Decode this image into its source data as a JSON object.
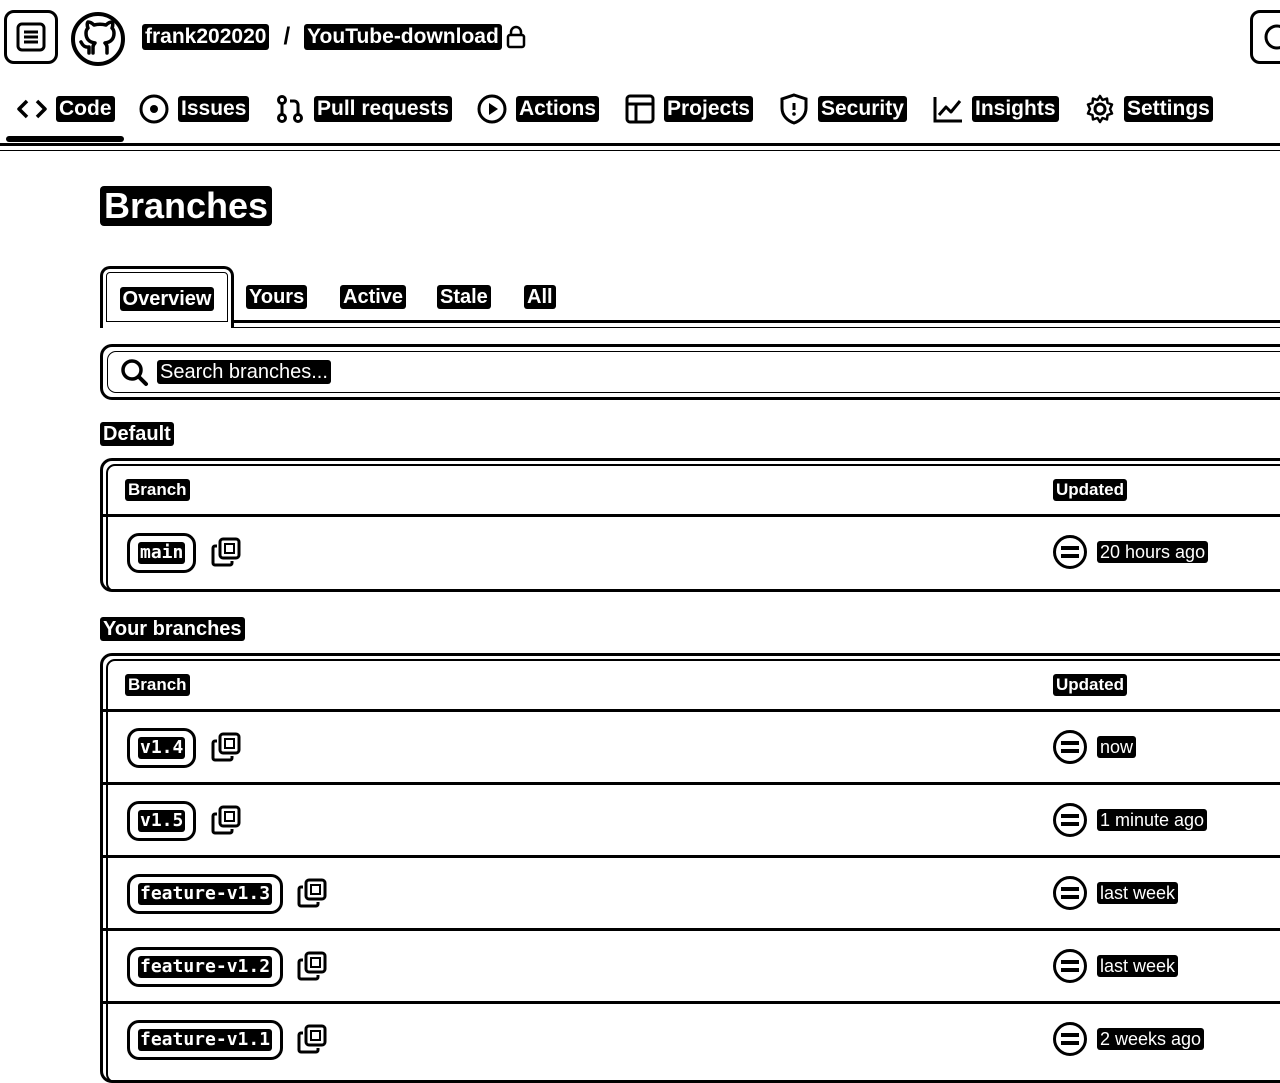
{
  "header": {
    "owner": "frank202020",
    "separator": "/",
    "repo": "YouTube-download"
  },
  "nav": {
    "tabs": [
      {
        "label": "Code",
        "icon": "code-icon"
      },
      {
        "label": "Issues",
        "icon": "issue-opened-icon"
      },
      {
        "label": "Pull requests",
        "icon": "git-pull-request-icon"
      },
      {
        "label": "Actions",
        "icon": "play-icon"
      },
      {
        "label": "Projects",
        "icon": "table-icon"
      },
      {
        "label": "Security",
        "icon": "shield-icon"
      },
      {
        "label": "Insights",
        "icon": "graph-icon"
      },
      {
        "label": "Settings",
        "icon": "gear-icon"
      }
    ],
    "selected": "Code"
  },
  "page": {
    "title": "Branches"
  },
  "branch_tabs": {
    "items": [
      "Overview",
      "Yours",
      "Active",
      "Stale",
      "All"
    ],
    "selected": "Overview"
  },
  "search": {
    "placeholder": "Search branches..."
  },
  "default_section": {
    "label": "Default",
    "col_branch": "Branch",
    "col_updated": "Updated",
    "rows": [
      {
        "branch": "main",
        "updated": "20 hours ago"
      }
    ]
  },
  "your_section": {
    "label": "Your branches",
    "col_branch": "Branch",
    "col_updated": "Updated",
    "rows": [
      {
        "branch": "v1.4",
        "updated": "now"
      },
      {
        "branch": "v1.5",
        "updated": "1 minute ago"
      },
      {
        "branch": "feature-v1.3",
        "updated": "last week"
      },
      {
        "branch": "feature-v1.2",
        "updated": "last week"
      },
      {
        "branch": "feature-v1.1",
        "updated": "2 weeks ago"
      }
    ]
  }
}
